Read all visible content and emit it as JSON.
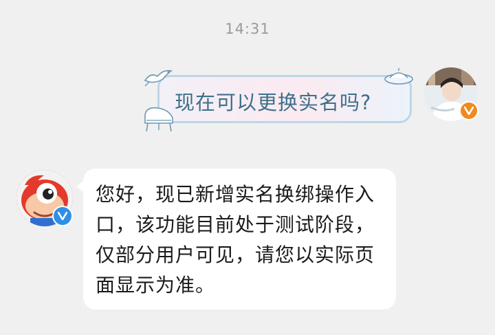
{
  "chat": {
    "timestamp": "14:31",
    "outgoing": {
      "text": "现在可以更换实名吗?",
      "bubble_colors": {
        "border": "#bcd6e4",
        "text": "#3e6f8a"
      },
      "sender_badge": "vip-v-badge-icon",
      "badge_color": "#f08a1e"
    },
    "incoming": {
      "text": "您好，现已新增实名换绑操作入口，该功能目前处于测试阶段，仅部分用户可见，请您以实际页面显示为准。",
      "sender_avatar": "weibo-mascot-avatar",
      "sender_badge": "verified-v-badge-icon",
      "badge_color": "#2f8fe8"
    }
  }
}
